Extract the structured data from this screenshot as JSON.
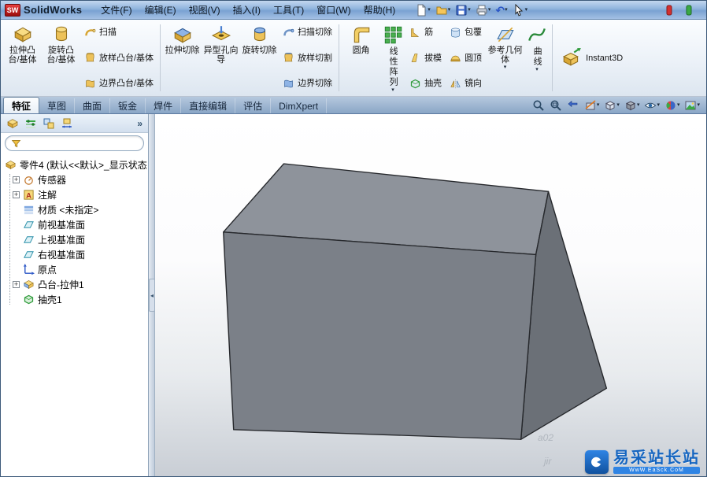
{
  "window": {
    "logo": "SW",
    "brand": "SolidWorks"
  },
  "menu": {
    "items": [
      "文件(F)",
      "编辑(E)",
      "视图(V)",
      "插入(I)",
      "工具(T)",
      "窗口(W)",
      "帮助(H)"
    ]
  },
  "ribbon": {
    "big": [
      {
        "label": "拉伸凸台/基体"
      },
      {
        "label": "旋转凸台/基体"
      },
      {
        "label": "拉伸切除"
      },
      {
        "label": "异型孔向导"
      },
      {
        "label": "旋转切除"
      },
      {
        "label": "圆角"
      },
      {
        "label": "线性阵列"
      },
      {
        "label": "参考几何体"
      },
      {
        "label": "曲线"
      },
      {
        "label": "Instant3D"
      }
    ],
    "small": [
      {
        "label": "扫描"
      },
      {
        "label": "放样凸台/基体"
      },
      {
        "label": "边界凸台/基体"
      },
      {
        "label": "扫描切除"
      },
      {
        "label": "放样切割"
      },
      {
        "label": "边界切除"
      },
      {
        "label": "筋"
      },
      {
        "label": "拔模"
      },
      {
        "label": "抽壳"
      },
      {
        "label": "包覆"
      },
      {
        "label": "圆顶"
      },
      {
        "label": "镜向"
      }
    ]
  },
  "tabs": {
    "items": [
      "特征",
      "草图",
      "曲面",
      "钣金",
      "焊件",
      "直接编辑",
      "评估",
      "DimXpert"
    ],
    "active": "特征"
  },
  "feature_tree": {
    "items": [
      {
        "label": "零件4 (默认<<默认>_显示状态"
      },
      {
        "label": "传感器"
      },
      {
        "label": "注解"
      },
      {
        "label": "材质 <未指定>"
      },
      {
        "label": "前视基准面"
      },
      {
        "label": "上视基准面"
      },
      {
        "label": "右视基准面"
      },
      {
        "label": "原点"
      },
      {
        "label": "凸台-拉伸1"
      },
      {
        "label": "抽壳1"
      }
    ]
  },
  "watermark": {
    "brand": "易采站长站",
    "sub": "WwW.EaSck.CoM",
    "faint_1": "a02",
    "faint_2": "jir"
  },
  "icons": {
    "quick_access": [
      "new-document-icon",
      "open-icon",
      "save-icon",
      "print-icon",
      "undo-icon",
      "select-arrow-icon",
      "rebuild-stop-icon",
      "rebuild-go-icon"
    ],
    "view_toolbar": [
      "zoom-fit-icon",
      "zoom-area-icon",
      "previous-view-icon",
      "section-view-icon",
      "view-orientation-icon",
      "display-style-icon",
      "hide-show-items-icon",
      "edit-appearance-icon",
      "apply-scene-icon"
    ],
    "panel_tabs": [
      "featuremanager-tab-icon",
      "propertymanager-tab-icon",
      "configurationmanager-tab-icon",
      "dimxpertmanager-tab-icon"
    ]
  },
  "colors": {
    "titlebar_blue": "#8fb3dd",
    "ribbon_bg": "#eaf0f7",
    "box_top": "#8e939b",
    "box_front": "#7b8088",
    "box_right": "#6b7077",
    "accent_gold": "#e8b23c",
    "brand_blue": "#1565c0"
  }
}
